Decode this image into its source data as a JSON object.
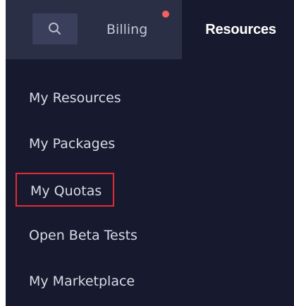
{
  "header": {
    "search_icon": "search-icon",
    "billing_label": "Billing",
    "billing_badge_color": "#f5605e",
    "resources_tab_label": "Resources"
  },
  "menu": {
    "items": [
      {
        "label": "My Resources"
      },
      {
        "label": "My Packages"
      },
      {
        "label": "My Quotas",
        "highlighted": true,
        "highlight_color": "#e22b34"
      },
      {
        "label": "Open Beta Tests"
      },
      {
        "label": "My Marketplace"
      }
    ]
  }
}
